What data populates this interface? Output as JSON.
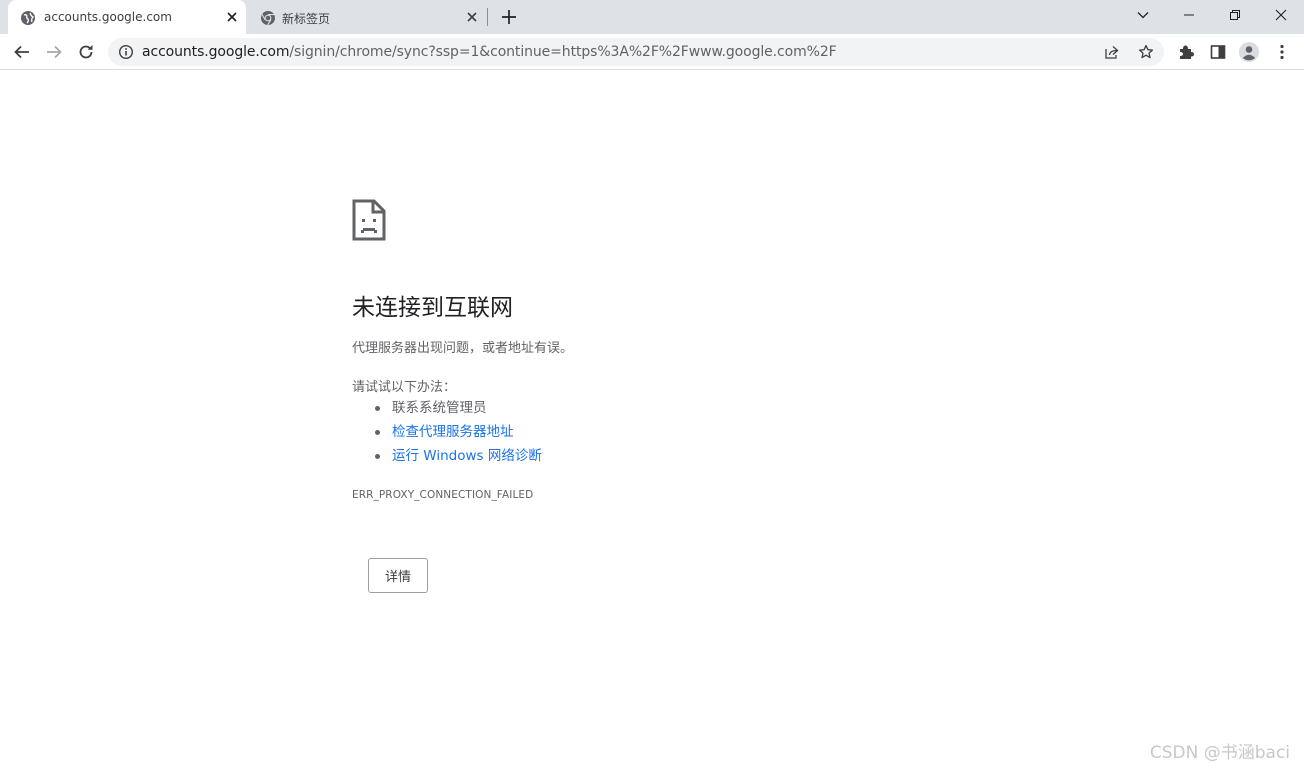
{
  "browser": {
    "tabs": [
      {
        "title": "accounts.google.com",
        "active": true,
        "favicon": "globe-icon"
      },
      {
        "title": "新标签页",
        "active": false,
        "favicon": "chrome-icon"
      }
    ],
    "window_controls": [
      "chevron-down-icon",
      "minimize-icon",
      "restore-icon",
      "close-icon"
    ],
    "address_bar": {
      "host": "accounts.google.com",
      "path": "/signin/chrome/sync?ssp=1&continue=https%3A%2F%2Fwww.google.com%2F"
    },
    "toolbar_icons": [
      "back-icon",
      "forward-icon",
      "reload-icon",
      "share-icon",
      "bookmark-star-icon",
      "extensions-icon",
      "side-panel-icon",
      "profile-icon",
      "menu-icon"
    ]
  },
  "error_page": {
    "icon": "sad-page-icon",
    "title": "未连接到互联网",
    "summary": "代理服务器出现问题，或者地址有误。",
    "try_heading": "请试试以下办法：",
    "suggestions": [
      {
        "text": "联系系统管理员",
        "link": false
      },
      {
        "text": "检查代理服务器地址",
        "link": true
      },
      {
        "text": "运行 Windows 网络诊断",
        "link": true
      }
    ],
    "error_code": "ERR_PROXY_CONNECTION_FAILED",
    "details_button": "详情"
  },
  "watermark": "CSDN @书涵baci",
  "colors": {
    "tabstrip_bg": "#dee1e6",
    "link": "#1a73e8",
    "text_primary": "#202124",
    "text_secondary": "#5f6368",
    "omnibox_bg": "#f1f3f4"
  }
}
